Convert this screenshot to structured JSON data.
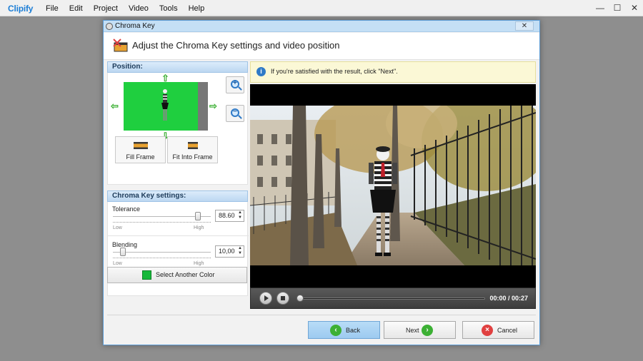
{
  "app": {
    "logo": "Clipify",
    "menu": [
      "File",
      "Edit",
      "Project",
      "Video",
      "Tools",
      "Help"
    ],
    "window_controls": {
      "minimize": "—",
      "maximize": "☐",
      "close": "✕"
    }
  },
  "dialog": {
    "title": "Chroma Key",
    "close": "✕",
    "header_title": "Adjust the Chroma Key settings and video position"
  },
  "position": {
    "header": "Position:",
    "fill_frame": "Fill Frame",
    "fit_into_frame": "Fit Into Frame"
  },
  "chroma": {
    "header": "Chroma Key settings:",
    "tolerance": {
      "label": "Tolerance",
      "value": "88.60",
      "level": 0.87,
      "low": "Low",
      "high": "High"
    },
    "blending": {
      "label": "Blending",
      "value": "10,00",
      "level": 0.1,
      "low": "Low",
      "high": "High"
    },
    "select_color": "Select Another Color",
    "key_color": "#16b83a"
  },
  "info": {
    "icon": "i",
    "text": "If you're satisfied with the result, click \"Next\"."
  },
  "player": {
    "time": "00:00 / 00:27",
    "progress": 0.0
  },
  "buttons": {
    "back": "Back",
    "next": "Next",
    "cancel": "Cancel"
  },
  "colors": {
    "accent": "#2f7ac7",
    "green": "#3cb034",
    "cancel_red": "#e04040"
  }
}
